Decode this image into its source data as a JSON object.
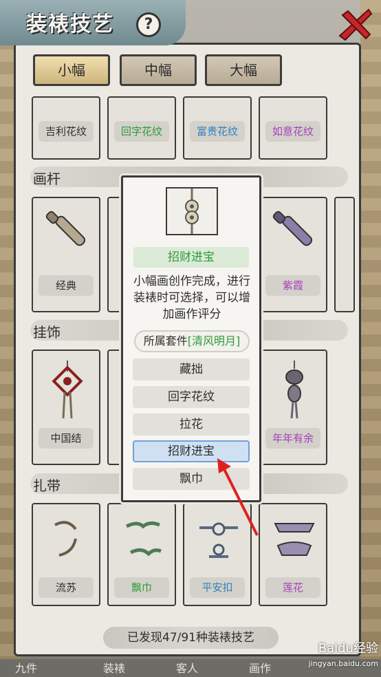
{
  "title": "装裱技艺",
  "help_glyph": "?",
  "tabs": [
    "小幅",
    "中幅",
    "大幅"
  ],
  "sections": {
    "huagan": "画杆",
    "guashi": "挂饰",
    "zhadai": "扎带"
  },
  "row1": [
    "吉利花纹",
    "回字花纹",
    "富贵花纹",
    "如意花纹"
  ],
  "row2": [
    "经典",
    "紫霞"
  ],
  "row3": [
    "中国结",
    "年年有余"
  ],
  "row4": [
    "流苏",
    "飘巾",
    "平安扣",
    "莲花"
  ],
  "popup": {
    "name": "招财进宝",
    "description": "小幅画创作完成，进行装裱时可选择，可以增加画作评分",
    "set_label": "所属套件",
    "set_name": "[清风明月]",
    "options": [
      "藏拙",
      "回字花纹",
      "拉花",
      "招财进宝",
      "飘巾"
    ],
    "selected_index": 3
  },
  "found_text": "已发现47/91种装裱技艺",
  "bottom_nav": [
    "九件",
    "装裱",
    "客人",
    "画作"
  ],
  "watermark": {
    "brand": "Baidu经验",
    "url": "jingyan.baidu.com"
  },
  "colors": {
    "green": "#2f9a3a",
    "blue": "#2f7fbf",
    "purple": "#a640b8",
    "arrow": "#e02020"
  }
}
